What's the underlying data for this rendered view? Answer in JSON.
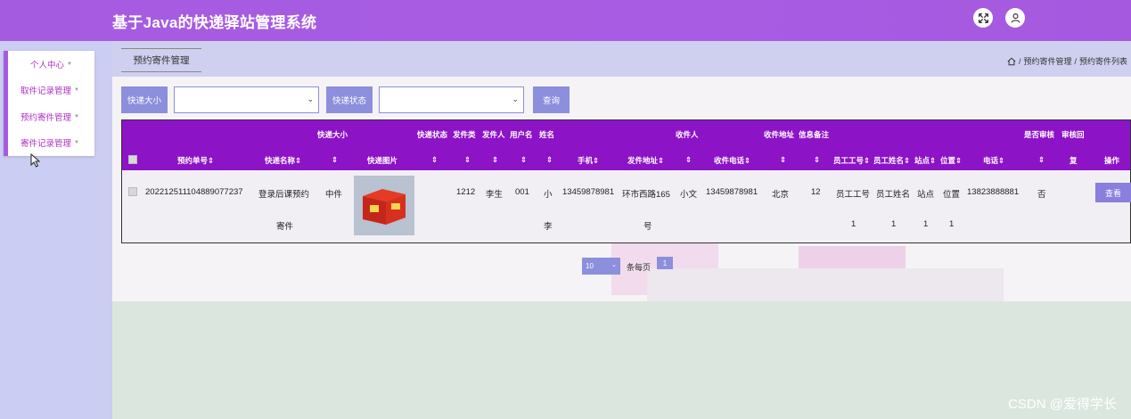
{
  "header": {
    "title": "基于Java的快递驿站管理系统"
  },
  "sidebar": {
    "items": [
      {
        "label": "个人中心"
      },
      {
        "label": "取件记录管理"
      },
      {
        "label": "预约寄件管理"
      },
      {
        "label": "寄件记录管理"
      }
    ]
  },
  "page_tab": "预约寄件管理",
  "breadcrumb": {
    "parent": "预约寄件管理",
    "sep": "/",
    "current": "预约寄件列表"
  },
  "search": {
    "size_label": "快递大小",
    "status_label": "快递状态",
    "query_button": "查询"
  },
  "table": {
    "header_top": {
      "size": "快递大小",
      "status": "快递状态",
      "fajianlei": "发件类",
      "sender": "发件人",
      "username": "用户名",
      "name": "姓名",
      "receiver": "收件人",
      "recv_addr": "收件地址",
      "info_note": "信息备注",
      "audit": "是否审核",
      "reply": "审核回"
    },
    "header_bottom": {
      "order_no": "预约单号",
      "express_name": "快递名称",
      "photo": "快递图片",
      "phone": "手机",
      "send_addr": "发件地址",
      "recv_phone": "收件电话",
      "emp_no": "员工工号",
      "emp_name": "员工姓名",
      "station": "站点",
      "position": "位置",
      "tel": "电话",
      "reply2": "复",
      "op": "操作"
    },
    "row": {
      "order_no": "202212511104889077237",
      "express_name_1": "登录后课预约",
      "express_name_2": "寄件",
      "size": "中件",
      "fajianlei": "1212",
      "sender": "李生",
      "username": "001",
      "name_1": "小",
      "name_2": "李",
      "phone": "13459878981",
      "send_addr_1": "环市西路165",
      "send_addr_2": "号",
      "receiver": "小文",
      "recv_phone": "13459878981",
      "recv_addr": "北京",
      "info_note": "12",
      "emp_no_1": "员工工号",
      "emp_no_2": "1",
      "emp_name_1": "员工姓名",
      "emp_name_2": "1",
      "station_1": "站点",
      "station_2": "1",
      "position_1": "位置",
      "position_2": "1",
      "tel": "13823888881",
      "audit": "否",
      "view_button": "查看"
    }
  },
  "pagination": {
    "page_size": "10",
    "per_page_label": "条每页",
    "current_page": "1"
  },
  "watermark": "CSDN @爱得学长"
}
